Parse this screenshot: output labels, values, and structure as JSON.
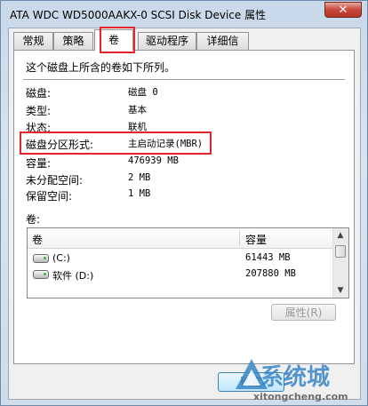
{
  "window": {
    "title": "ATA WDC WD5000AAKX-0 SCSI Disk Device 属性",
    "close_glyph": "✕"
  },
  "tabs": [
    {
      "label": "常规",
      "active": false
    },
    {
      "label": "策略",
      "active": false
    },
    {
      "label": "卷",
      "active": true
    },
    {
      "label": "驱动程序",
      "active": false
    },
    {
      "label": "详细信息",
      "active": false
    }
  ],
  "volume_tab": {
    "description": "这个磁盘上所含的卷如下所列。",
    "properties": [
      {
        "label": "磁盘:",
        "value": "磁盘 0"
      },
      {
        "label": "类型:",
        "value": "基本"
      },
      {
        "label": "状态:",
        "value": "联机"
      },
      {
        "label": "磁盘分区形式:",
        "value": "主启动记录(MBR)"
      },
      {
        "label": "容量:",
        "value": "476939 MB"
      },
      {
        "label": "未分配空间:",
        "value": "2 MB"
      },
      {
        "label": "保留空间:",
        "value": "1 MB"
      }
    ],
    "volumes_label": "卷:",
    "volumes_table": {
      "headers": [
        "卷",
        "容量"
      ],
      "rows": [
        {
          "name": "(C:)",
          "size": "61443 MB"
        },
        {
          "name": "软件 (D:)",
          "size": "207880 MB"
        }
      ]
    },
    "properties_button": "属性(R)"
  },
  "footer": {
    "ok_button": "确定"
  },
  "watermark": {
    "brand": "系统城",
    "url": "xitongcheng.com"
  },
  "colors": {
    "highlight_box": "#e3262a",
    "close_button": "#c7473a"
  }
}
